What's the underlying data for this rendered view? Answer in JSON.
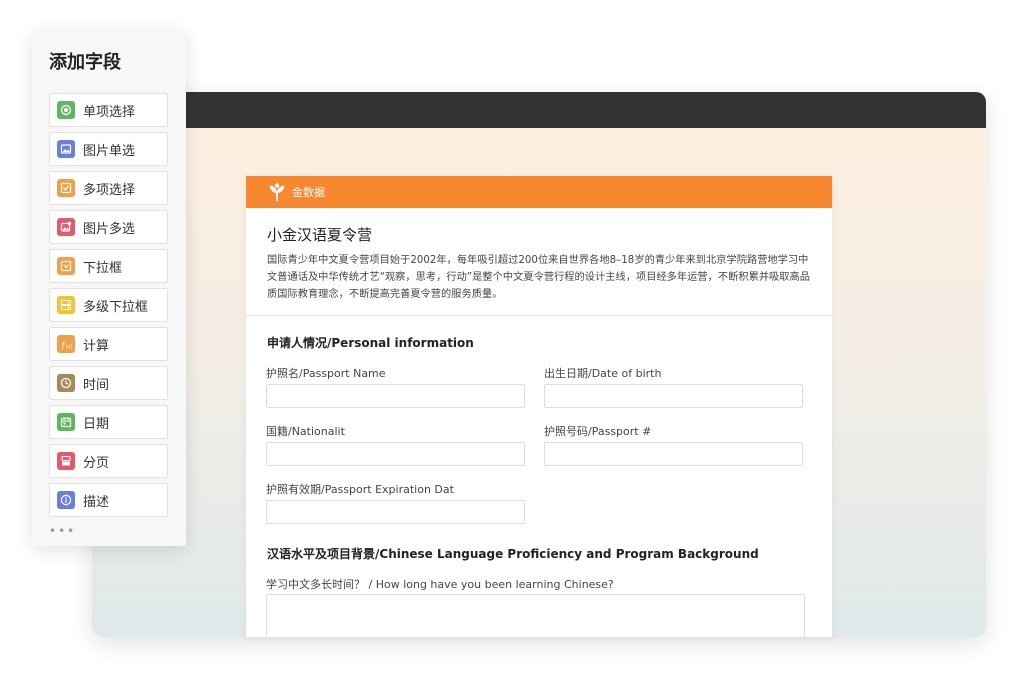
{
  "panel": {
    "title": "添加字段",
    "items": [
      {
        "label": "单项选择",
        "icon": "radio-icon",
        "color": "#5cb85c"
      },
      {
        "label": "图片单选",
        "icon": "image-single-icon",
        "color": "#6a7fdb"
      },
      {
        "label": "多项选择",
        "icon": "checkbox-icon",
        "color": "#f0a048"
      },
      {
        "label": "图片多选",
        "icon": "image-multi-icon",
        "color": "#e25a6b"
      },
      {
        "label": "下拉框",
        "icon": "dropdown-icon",
        "color": "#f0a048"
      },
      {
        "label": "多级下拉框",
        "icon": "multi-dropdown-icon",
        "color": "#f2c230"
      },
      {
        "label": "计算",
        "icon": "function-icon",
        "color": "#f0a048"
      },
      {
        "label": "时间",
        "icon": "clock-icon",
        "color": "#a88a5a"
      },
      {
        "label": "日期",
        "icon": "calendar-icon",
        "color": "#5cb85c"
      },
      {
        "label": "分页",
        "icon": "pagination-icon",
        "color": "#e25a6b"
      },
      {
        "label": "描述",
        "icon": "info-icon",
        "color": "#6a7fdb"
      }
    ],
    "more": "•••"
  },
  "form": {
    "brand": "金数据",
    "brand_color": "#f7882f",
    "title": "小金汉语夏令营",
    "description": "国际青少年中文夏令营项目始于2002年，每年吸引超过200位来自世界各地8–18岁的青少年来到北京学院路营地学习中文普通话及中华传统才艺“观察，思考，行动”是整个中文夏令营行程的设计主线，项目经多年运营，不断积累并吸取高品质国际教育理念，不断提高完善夏令营的服务质量。",
    "section1": "申请人情况/Personal information",
    "fields": {
      "passport_name": "护照名/Passport Name",
      "dob": "出生日期/Date of birth",
      "nationality": "国籍/Nationalit",
      "passport_no": "护照号码/Passport #",
      "passport_exp": "护照有效期/Passport Expiration Dat"
    },
    "section2": "汉语水平及项目背景/Chinese Language Proficiency and Program Background",
    "question1": "学习中文多长时间？ / How long have you been learning Chinese?"
  }
}
